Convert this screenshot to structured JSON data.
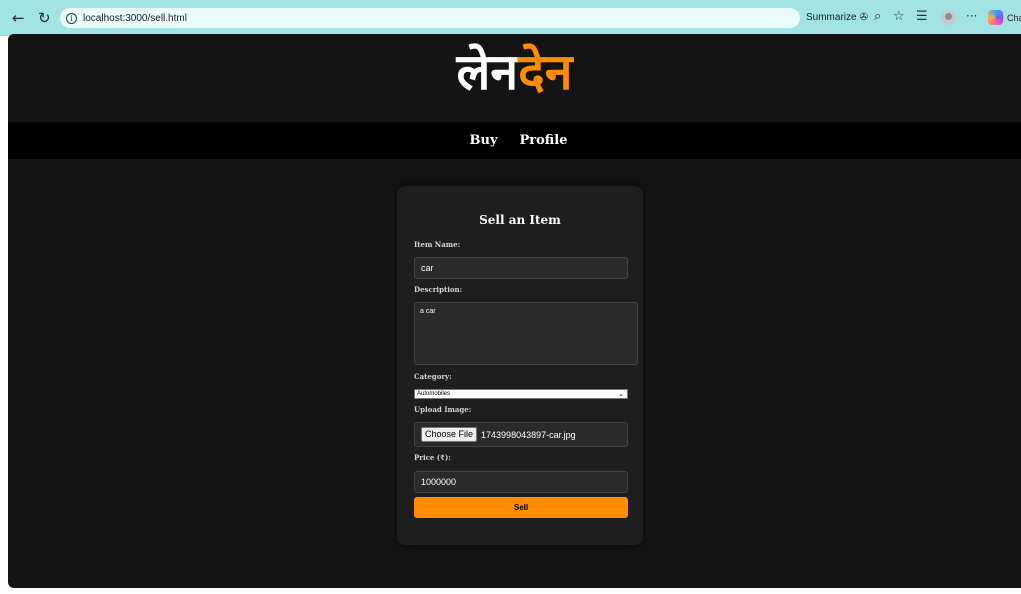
{
  "browser": {
    "url": "localhost:3000/sell.html",
    "summarize_label": "Summarize",
    "copilot_label": "Cha",
    "icons": [
      "back-arrow-icon",
      "reload-icon",
      "info-icon",
      "summarize-icon",
      "zoom-icon",
      "favorite-star-icon",
      "favorites-bar-icon",
      "profile-avatar-icon",
      "more-icon",
      "copilot-icon"
    ]
  },
  "site": {
    "logo_part_1": "लेन",
    "logo_part_2": "देन",
    "logo_colors": {
      "part_1": "#ffffff",
      "part_2": "#ff8c00"
    }
  },
  "nav": {
    "items": [
      {
        "label": "Buy"
      },
      {
        "label": "Profile"
      }
    ]
  },
  "form": {
    "title": "Sell an Item",
    "item_name": {
      "label": "Item Name:",
      "value": "car"
    },
    "description": {
      "label": "Description:",
      "value": "a car"
    },
    "category": {
      "label": "Category:",
      "selected": "Automobiles"
    },
    "upload_image": {
      "label": "Upload Image:",
      "button_label": "Choose File",
      "file_name": "1743998043897-car.jpg"
    },
    "price": {
      "label": "Price (₹):",
      "value": "1000000"
    },
    "submit_label": "Sell"
  },
  "colors": {
    "accent": "#ff8c00",
    "page_background": "#141414",
    "card_background": "#1e1e1e",
    "browser_bar": "#a2e3e3"
  }
}
